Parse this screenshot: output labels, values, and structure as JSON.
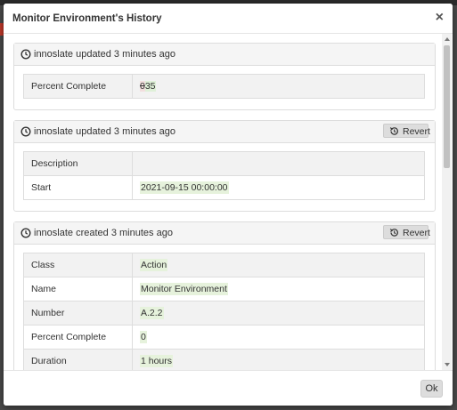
{
  "modal": {
    "title": "Monitor Environment's History",
    "close_glyph": "×",
    "ok_label": "Ok"
  },
  "panels": [
    {
      "header": "innoslate updated 3 minutes ago",
      "has_revert": false,
      "rows": [
        {
          "key": "Percent Complete",
          "deleted": "0",
          "inserted": "35"
        }
      ]
    },
    {
      "header": "innoslate updated 3 minutes ago",
      "has_revert": true,
      "revert_label": "Revert",
      "rows": [
        {
          "key": "Description",
          "value": ""
        },
        {
          "key": "Start",
          "value": "2021-09-15 00:00:00"
        }
      ]
    },
    {
      "header": "innoslate created 3 minutes ago",
      "has_revert": true,
      "revert_label": "Revert",
      "rows": [
        {
          "key": "Class",
          "value": "Action"
        },
        {
          "key": "Name",
          "value": "Monitor Environment"
        },
        {
          "key": "Number",
          "value": "A.2.2"
        },
        {
          "key": "Percent Complete",
          "value": "0"
        },
        {
          "key": "Duration",
          "value": "1 hours"
        }
      ]
    }
  ],
  "icons": {
    "clock": "clock-icon",
    "revert": "history-icon",
    "close": "close-icon"
  }
}
